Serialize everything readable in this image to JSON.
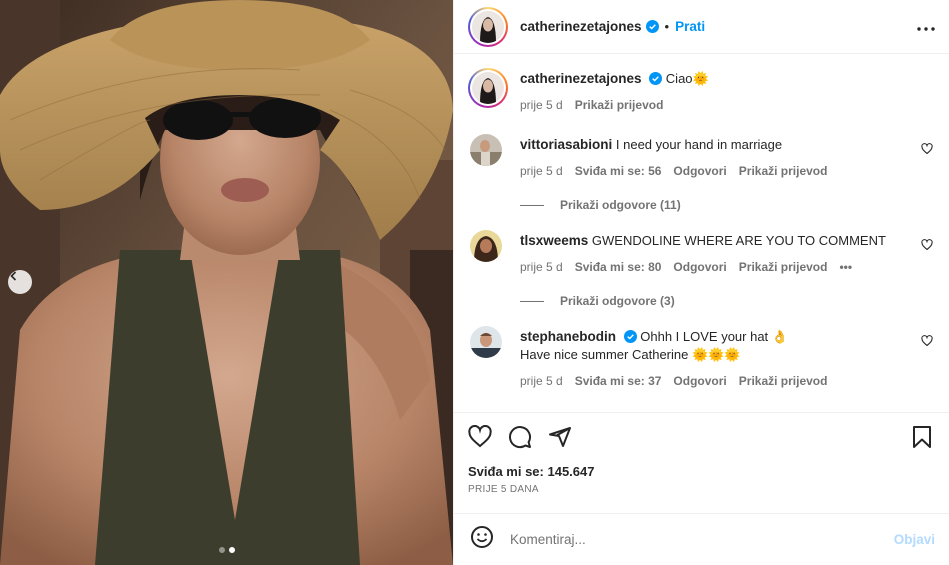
{
  "post": {
    "author": "catherinezetajones",
    "follow_label": "Prati",
    "separator": "•",
    "caption": {
      "username": "catherinezetajones",
      "text": "Ciao",
      "emoji": "🌞",
      "time": "prije 5 d",
      "translate_label": "Prikaži prijevod"
    },
    "image_dots": {
      "count": 2,
      "active_index": 1
    }
  },
  "comments": [
    {
      "username": "vittoriasabioni",
      "text": "I need your hand in marriage",
      "time": "prije 5 d",
      "likes_label": "Sviđa mi se: 56",
      "reply_label": "Odgovori",
      "translate_label": "Prikaži prijevod",
      "replies_label": "Prikaži odgovore (11)"
    },
    {
      "username": "tlsxweems",
      "text": "GWENDOLINE WHERE ARE YOU TO COMMENT",
      "time": "prije 5 d",
      "likes_label": "Sviđa mi se: 80",
      "reply_label": "Odgovori",
      "translate_label": "Prikaži prijevod",
      "more_label": "•••",
      "replies_label": "Prikaži odgovore (3)"
    },
    {
      "username": "stephanebodin",
      "line1": "Ohhh I LOVE your hat",
      "line1_emoji": "👌",
      "line2": "Have nice summer Catherine",
      "line2_emoji": "🌞🌞🌞",
      "time": "prije 5 d",
      "likes_label": "Sviđa mi se: 37",
      "reply_label": "Odgovori",
      "translate_label": "Prikaži prijevod"
    }
  ],
  "actions": {
    "likes_label": "Sviđa mi se: 145.647",
    "date_label": "PRIJE 5 DANA"
  },
  "composer": {
    "placeholder": "Komentiraj...",
    "post_label": "Objavi"
  },
  "colors": {
    "accent": "#0095f6",
    "verified": "#0095f6",
    "muted": "#737373",
    "post_disabled": "#b3dbff"
  }
}
